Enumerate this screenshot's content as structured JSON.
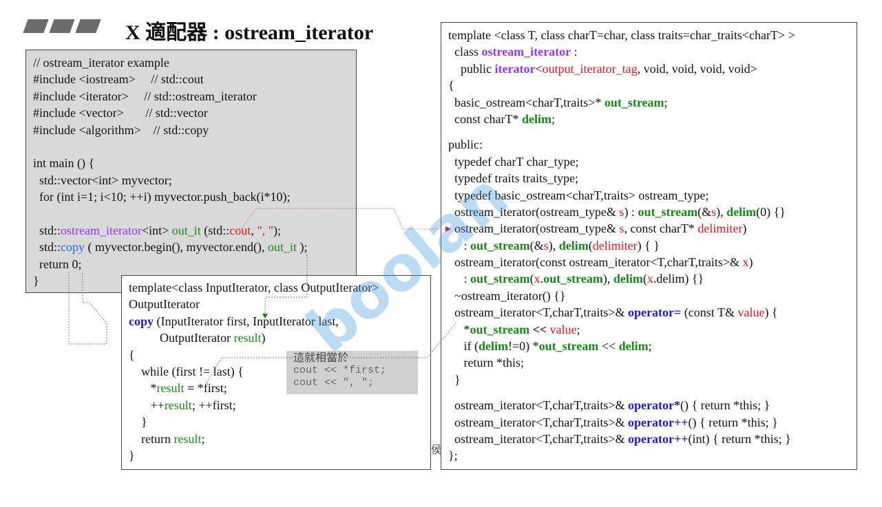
{
  "title": "X 適配器 : ostream_iterator",
  "watermark": "boolan",
  "fragment": "侯",
  "tooltip": {
    "heading": "這就相當於",
    "lines": [
      "cout << *first;",
      "cout << \", \";"
    ]
  },
  "colors": {
    "purple": "#9933ff",
    "red": "#e8141b",
    "green": "#138b13",
    "blue": "#1f6fe0",
    "panel_gray": "#d9d9d9"
  },
  "left_code": [
    [
      [
        "// ostream_iterator example",
        ""
      ]
    ],
    [
      [
        "#include <iostream>     // std::cout",
        ""
      ]
    ],
    [
      [
        "#include <iterator>     // std::ostream_iterator",
        ""
      ]
    ],
    [
      [
        "#include <vector>       // std::vector",
        ""
      ]
    ],
    [
      [
        "#include <algorithm>    // std::copy",
        ""
      ]
    ],
    [],
    [
      [
        "int main () {",
        ""
      ]
    ],
    [
      [
        "  std::vector<int> myvector;",
        ""
      ]
    ],
    [
      [
        "  for (int i=1; i<10; ++i) myvector.push_back(i*10);",
        ""
      ]
    ],
    [],
    [
      [
        "  std::",
        ""
      ],
      [
        "ostream_iterator",
        "p"
      ],
      [
        "<int> ",
        ""
      ],
      [
        "out_it",
        "g"
      ],
      [
        " (std::",
        ""
      ],
      [
        "cout",
        "r"
      ],
      [
        ", ",
        ""
      ],
      [
        "\", \"",
        "r"
      ],
      [
        ");",
        ""
      ]
    ],
    [
      [
        "  std::",
        ""
      ],
      [
        "copy",
        "bl"
      ],
      [
        " ( myvector.begin(), myvector.end(), ",
        ""
      ],
      [
        "out_it",
        "g"
      ],
      [
        " );",
        ""
      ]
    ],
    [
      [
        "  return 0;",
        ""
      ]
    ],
    [
      [
        "}",
        ""
      ]
    ]
  ],
  "copy_code": [
    [
      [
        "template<class InputIterator, class OutputIterator>",
        ""
      ]
    ],
    [
      [
        "OutputIterator",
        ""
      ]
    ],
    [
      [
        "copy",
        "bb"
      ],
      [
        " (InputIterator first, InputIterator last,",
        ""
      ]
    ],
    [
      [
        "          OutputIterator ",
        ""
      ],
      [
        "result",
        "g"
      ],
      [
        ")",
        ""
      ]
    ],
    [
      [
        "{",
        ""
      ]
    ],
    [
      [
        "    while (first != last) {",
        ""
      ]
    ],
    [
      [
        "       *",
        ""
      ],
      [
        "result",
        "g"
      ],
      [
        " = ",
        "bb"
      ],
      [
        "*first;",
        ""
      ]
    ],
    [
      [
        "       ++",
        ""
      ],
      [
        "result",
        "g"
      ],
      [
        "; ++first;",
        ""
      ]
    ],
    [
      [
        "    }",
        ""
      ]
    ],
    [
      [
        "    return ",
        ""
      ],
      [
        "result",
        "g"
      ],
      [
        ";",
        ""
      ]
    ],
    [
      [
        "}",
        ""
      ]
    ]
  ],
  "right_code": [
    [
      [
        "template <class T, class charT=char, class traits=char_traits<charT> >",
        ""
      ]
    ],
    [
      [
        "  class ",
        ""
      ],
      [
        "ostream_iterator",
        "pb"
      ],
      [
        " :",
        ""
      ]
    ],
    [
      [
        "    public ",
        ""
      ],
      [
        "iterator",
        "pb"
      ],
      [
        "<",
        ""
      ],
      [
        "output_iterator_tag",
        "r"
      ],
      [
        ", void, void, void, void>",
        ""
      ]
    ],
    [
      [
        "{",
        ""
      ]
    ],
    [
      [
        "  basic_ostream<charT,traits>* ",
        ""
      ],
      [
        "out_stream",
        "gb"
      ],
      [
        ";",
        ""
      ]
    ],
    [
      [
        "  const charT* ",
        ""
      ],
      [
        "delim",
        "gb"
      ],
      [
        ";",
        ""
      ]
    ],
    "gap",
    [
      [
        "public:",
        ""
      ]
    ],
    [
      [
        "  typedef charT char_type;",
        ""
      ]
    ],
    [
      [
        "  typedef traits traits_type;",
        ""
      ]
    ],
    [
      [
        "  typedef basic_ostream<charT,traits> ostream_type;",
        ""
      ]
    ],
    [
      [
        "  ostream_iterator(ostream_type& ",
        ""
      ],
      [
        "s",
        "r"
      ],
      [
        ") : ",
        ""
      ],
      [
        "out_stream",
        "gb"
      ],
      [
        "(&",
        ""
      ],
      [
        "s",
        "r"
      ],
      [
        "), ",
        ""
      ],
      [
        "delim",
        "gb"
      ],
      [
        "(0) {}",
        ""
      ]
    ],
    [
      [
        "  ostream_iterator(ostream_type& ",
        ""
      ],
      [
        "s",
        "r"
      ],
      [
        ", const charT* ",
        ""
      ],
      [
        "delimiter",
        "r"
      ],
      [
        ")",
        ""
      ]
    ],
    [
      [
        "     : ",
        ""
      ],
      [
        "out_stream",
        "gb"
      ],
      [
        "(&",
        ""
      ],
      [
        "s",
        "r"
      ],
      [
        "), ",
        ""
      ],
      [
        "delim",
        "gb"
      ],
      [
        "(",
        ""
      ],
      [
        "delimiter",
        "r"
      ],
      [
        ") { }",
        ""
      ]
    ],
    [
      [
        "  ostream_iterator(const ostream_iterator<T,charT,traits>& ",
        ""
      ],
      [
        "x",
        "r"
      ],
      [
        ")",
        ""
      ]
    ],
    [
      [
        "     : ",
        ""
      ],
      [
        "out_stream",
        "gb"
      ],
      [
        "(",
        ""
      ],
      [
        "x",
        "r"
      ],
      [
        ".",
        ""
      ],
      [
        "out_stream",
        "gb"
      ],
      [
        "), ",
        ""
      ],
      [
        "delim",
        "gb"
      ],
      [
        "(",
        ""
      ],
      [
        "x",
        "r"
      ],
      [
        ".delim) {}",
        ""
      ]
    ],
    [
      [
        "  ~ostream_iterator() {}",
        ""
      ]
    ],
    [
      [
        "  ostream_iterator<T,charT,traits>& ",
        ""
      ],
      [
        "operator=",
        "bb"
      ],
      [
        " (const T& ",
        ""
      ],
      [
        "value",
        "r"
      ],
      [
        ") {",
        ""
      ]
    ],
    [
      [
        "     *",
        ""
      ],
      [
        "out_stream",
        "gb"
      ],
      [
        " << ",
        "b"
      ],
      [
        "value",
        "r"
      ],
      [
        ";",
        ""
      ]
    ],
    [
      [
        "     if (",
        ""
      ],
      [
        "delim",
        "gb"
      ],
      [
        "!=0) *",
        ""
      ],
      [
        "out_stream",
        "gb"
      ],
      [
        " << ",
        ""
      ],
      [
        "delim",
        "gb"
      ],
      [
        ";",
        ""
      ]
    ],
    [
      [
        "     return *this;",
        ""
      ]
    ],
    [
      [
        "  }",
        ""
      ]
    ],
    "gap",
    [
      [
        "  ostream_iterator<T,charT,traits>& ",
        ""
      ],
      [
        "operator*",
        "bb"
      ],
      [
        "() { return *this; }",
        ""
      ]
    ],
    [
      [
        "  ostream_iterator<T,charT,traits>& ",
        ""
      ],
      [
        "operator++",
        "bb"
      ],
      [
        "() { return *this; }",
        ""
      ]
    ],
    [
      [
        "  ostream_iterator<T,charT,traits>& ",
        ""
      ],
      [
        "operator++",
        "bb"
      ],
      [
        "(int) { return *this; }",
        ""
      ]
    ],
    [
      [
        "};",
        ""
      ]
    ]
  ]
}
